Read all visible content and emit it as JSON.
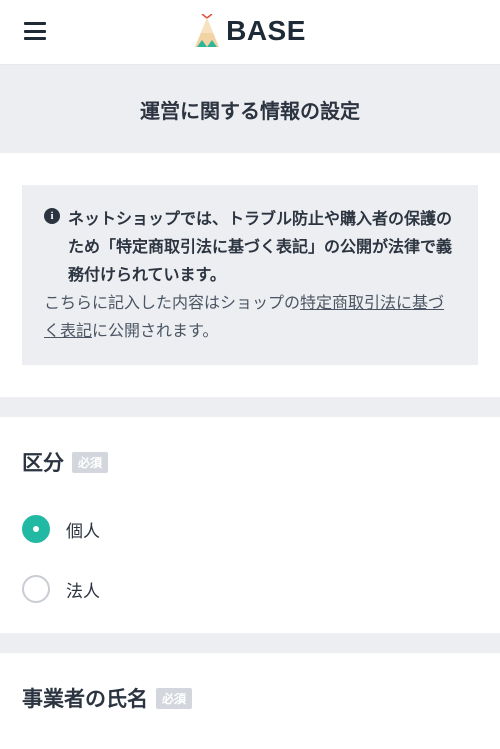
{
  "header": {
    "brand": "BASE",
    "menu_icon": "hamburger-menu-icon",
    "logo_icon": "tent-logo-icon"
  },
  "page": {
    "title": "運営に関する情報の設定"
  },
  "notice": {
    "icon": "info-icon",
    "bold_text": "ネットショップでは、トラブル防止や購入者の保護のため「特定商取引法に基づく表記」の公開が法律で義務付けられています。",
    "sub_prefix": "こちらに記入した内容はショップの",
    "link_text": "特定商取引法に基づく表記",
    "sub_suffix": "に公開されます。"
  },
  "form": {
    "category": {
      "label": "区分",
      "badge": "必須",
      "options": [
        {
          "label": "個人",
          "checked": true
        },
        {
          "label": "法人",
          "checked": false
        }
      ]
    },
    "operator_name": {
      "label": "事業者の氏名",
      "badge": "必須"
    }
  },
  "colors": {
    "accent": "#21b9a3",
    "text": "#2b3440",
    "panel": "#eceef1",
    "badge": "#d3d7dd"
  }
}
